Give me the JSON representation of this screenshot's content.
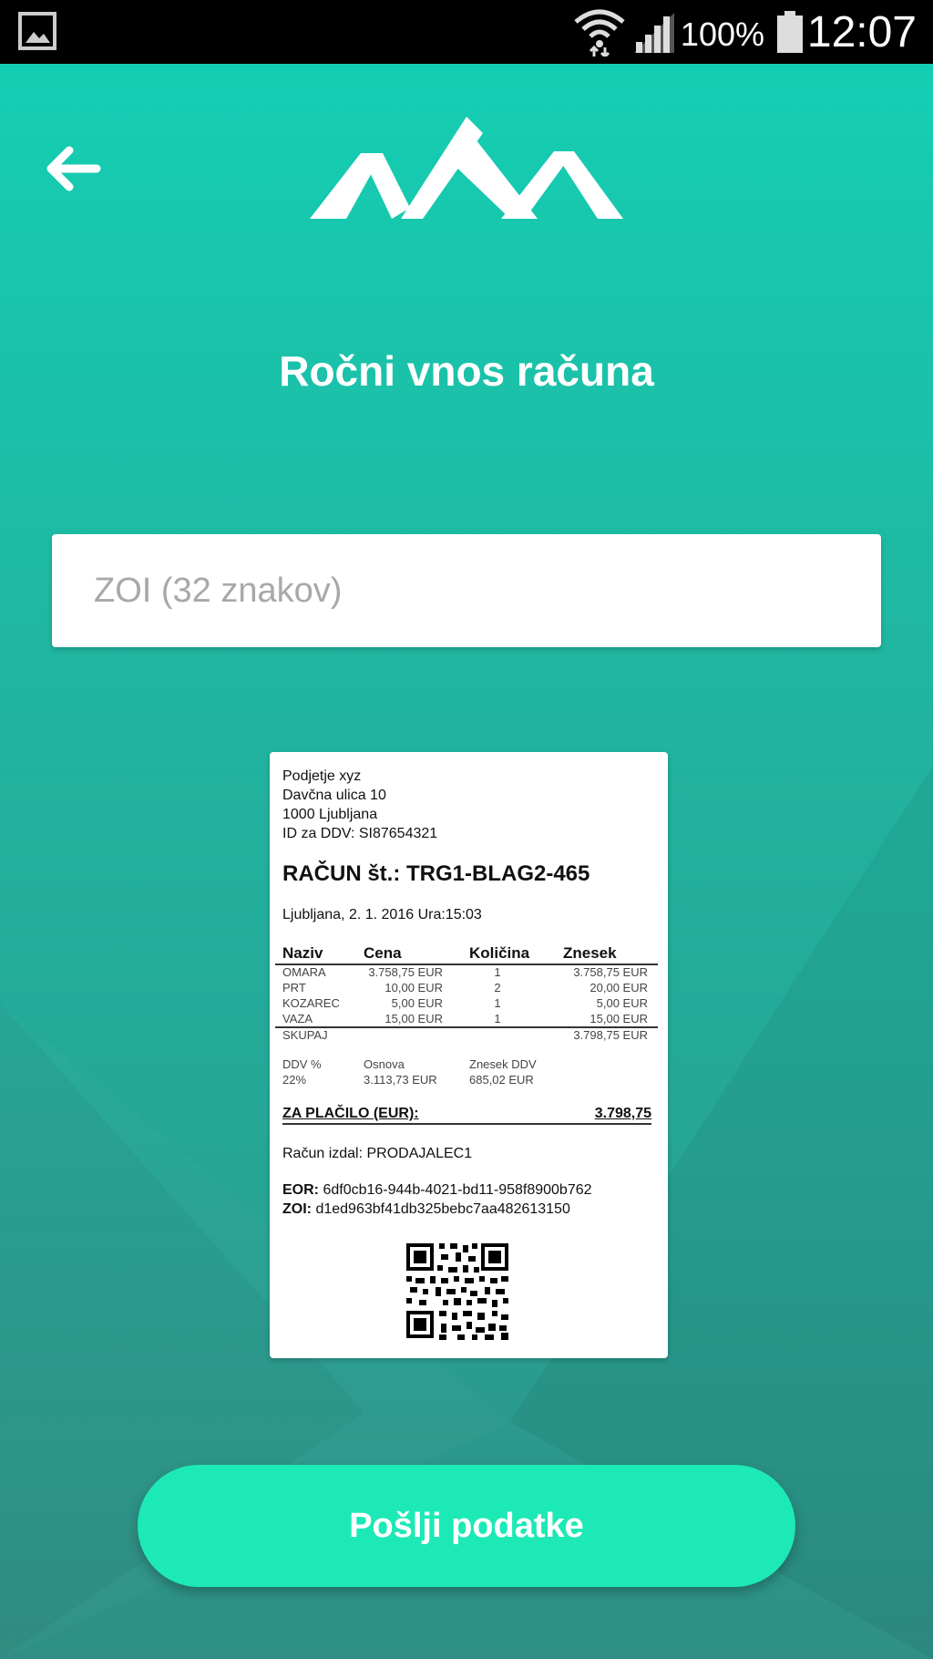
{
  "status_bar": {
    "battery_text": "100%",
    "time": "12:07"
  },
  "header": {
    "back_icon": "arrow-left-icon",
    "logo_icon": "mountain-logo-icon"
  },
  "page": {
    "title": "Ročni vnos računa"
  },
  "zoi_input": {
    "placeholder": "ZOI (32 znakov)",
    "value": ""
  },
  "receipt": {
    "company": "Podjetje xyz",
    "street": "Davčna ulica 10",
    "city": "1000 Ljubljana",
    "vat_id": "ID za DDV: SI87654321",
    "title": "RAČUN št.: TRG1-BLAG2-465",
    "date_line": "Ljubljana, 2. 1. 2016  Ura:15:03",
    "columns": [
      "Naziv",
      "Cena",
      "Količina",
      "Znesek"
    ],
    "rows": [
      {
        "name": "OMARA",
        "price": "3.758,75 EUR",
        "qty": "1",
        "amount": "3.758,75 EUR"
      },
      {
        "name": "PRT",
        "price": "10,00 EUR",
        "qty": "2",
        "amount": "20,00 EUR"
      },
      {
        "name": "KOZAREC",
        "price": "5,00 EUR",
        "qty": "1",
        "amount": "5,00 EUR"
      },
      {
        "name": "VAZA",
        "price": "15,00 EUR",
        "qty": "1",
        "amount": "15,00 EUR"
      }
    ],
    "total_label": "SKUPAJ",
    "total_value": "3.798,75 EUR",
    "vat_headers": [
      "DDV %",
      "Osnova",
      "Znesek DDV"
    ],
    "vat_values": [
      "22%",
      "3.113,73 EUR",
      "685,02 EUR"
    ],
    "pay_label": "ZA PLAČILO (EUR):",
    "pay_value": "3.798,75",
    "issuer": "Račun izdal: PRODAJALEC1",
    "eor_label": "EOR:",
    "eor_value": "6df0cb16-944b-4021-bd11-958f8900b762",
    "zoi_label": "ZOI:",
    "zoi_value": "d1ed963bf41db325bebc7aa482613150",
    "qr_icon": "qr-code-icon"
  },
  "actions": {
    "send_label": "Pošlji podatke"
  },
  "colors": {
    "status_bar": "#000000",
    "background_top": "#13d1b5",
    "background_bottom": "#2f8f86",
    "button": "#1de9b6",
    "text_light": "#ffffff"
  }
}
